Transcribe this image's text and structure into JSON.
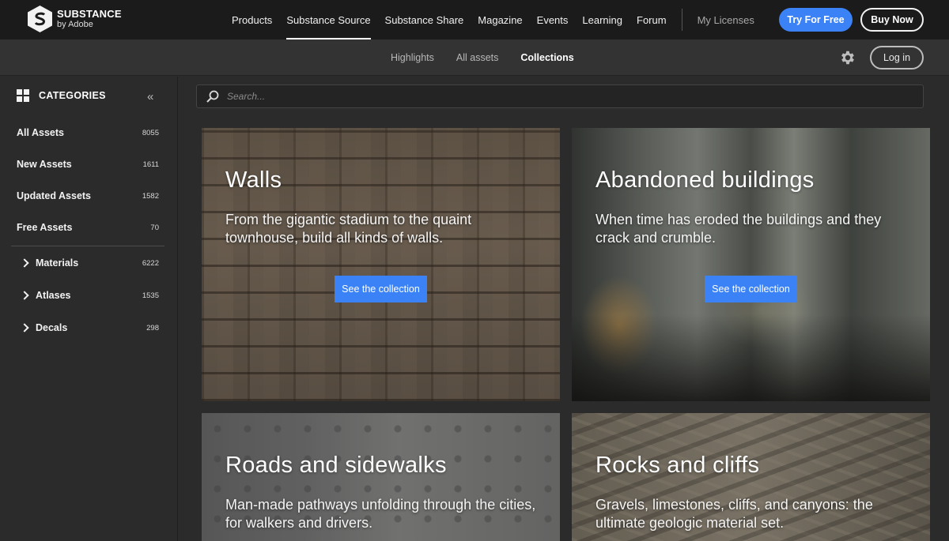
{
  "brand": {
    "name": "SUBSTANCE",
    "byline": "by Adobe"
  },
  "topnav": {
    "items": [
      "Products",
      "Substance Source",
      "Substance Share",
      "Magazine",
      "Events",
      "Learning",
      "Forum"
    ],
    "active": "Substance Source",
    "licenses": "My Licenses",
    "try_label": "Try For Free",
    "buy_label": "Buy Now"
  },
  "subnav": {
    "items": [
      "Highlights",
      "All assets",
      "Collections"
    ],
    "active": "Collections",
    "login_label": "Log in"
  },
  "sidebar": {
    "title": "CATEGORIES",
    "items": [
      {
        "label": "All Assets",
        "count": "8055"
      },
      {
        "label": "New Assets",
        "count": "1611"
      },
      {
        "label": "Updated Assets",
        "count": "1582"
      },
      {
        "label": "Free Assets",
        "count": "70"
      }
    ],
    "tree": [
      {
        "label": "Materials",
        "count": "6222"
      },
      {
        "label": "Atlases",
        "count": "1535"
      },
      {
        "label": "Decals",
        "count": "298"
      }
    ]
  },
  "search": {
    "placeholder": "Search..."
  },
  "collections": [
    {
      "title": "Walls",
      "description": "From the gigantic stadium to the quaint townhouse, build all kinds of walls.",
      "cta": "See the collection"
    },
    {
      "title": "Abandoned buildings",
      "description": "When time has eroded the buildings and they crack and crumble.",
      "cta": "See the collection"
    },
    {
      "title": "Roads and sidewalks",
      "description": "Man-made pathways unfolding through the cities, for walkers and drivers."
    },
    {
      "title": "Rocks and cliffs",
      "description": "Gravels, limestones, cliffs, and canyons: the ultimate geologic material set."
    }
  ],
  "colors": {
    "accent": "#3b82f6",
    "topbar": "#1b1b1b",
    "subbar": "#333333",
    "panel": "#2b2b2b"
  }
}
